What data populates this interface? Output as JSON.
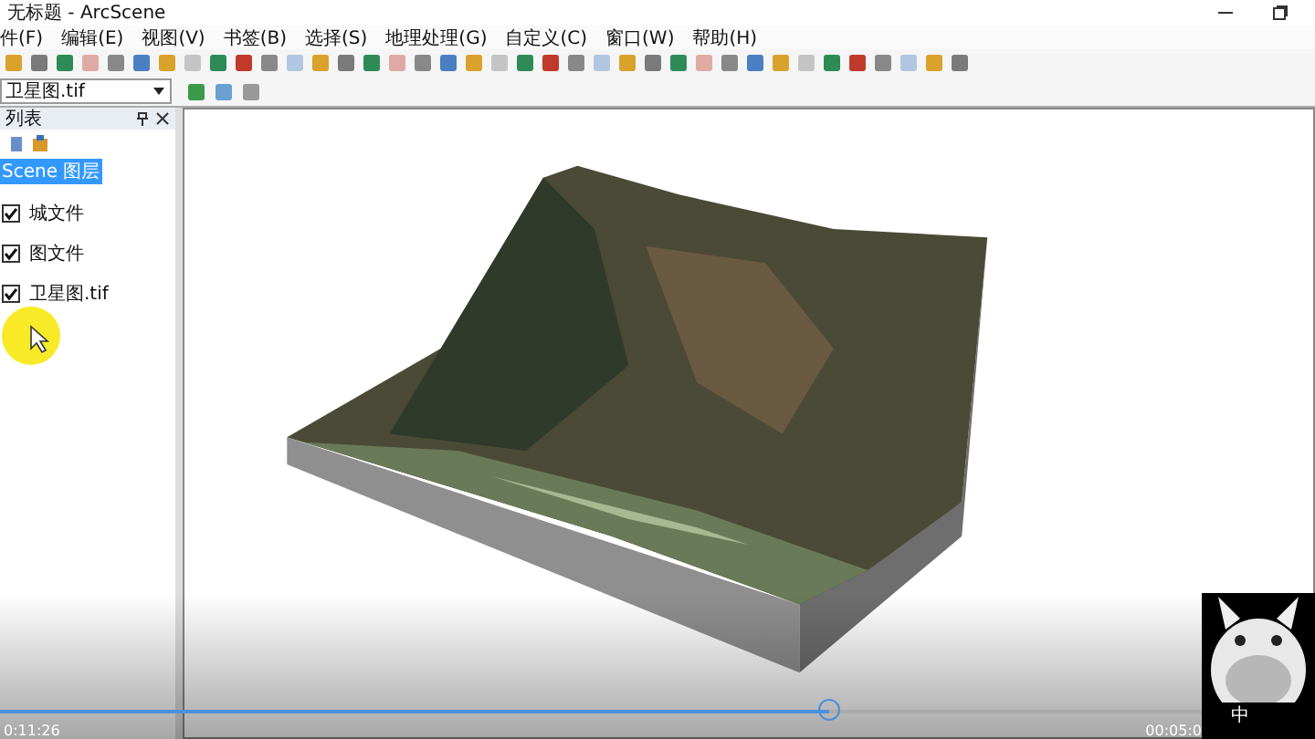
{
  "window": {
    "title": "无标题 - ArcScene"
  },
  "menu": [
    "件(F)",
    "编辑(E)",
    "视图(V)",
    "书签(B)",
    "选择(S)",
    "地理处理(G)",
    "自定义(C)",
    "窗口(W)",
    "帮助(H)"
  ],
  "layer_select": {
    "value": "卫星图.tif"
  },
  "toc": {
    "title": "列表",
    "items": [
      {
        "label": "Scene 图层",
        "selected": true,
        "children": [
          {
            "label": "城文件",
            "selected": false,
            "checked": true
          },
          {
            "label": "图文件",
            "selected": false,
            "checked": true
          },
          {
            "label": "卫星图.tif",
            "selected": false,
            "checked": true
          }
        ]
      }
    ]
  },
  "player": {
    "level": 0.69,
    "elapsed": "0:11:26",
    "total": "00:05:0",
    "logo_text": "中"
  }
}
